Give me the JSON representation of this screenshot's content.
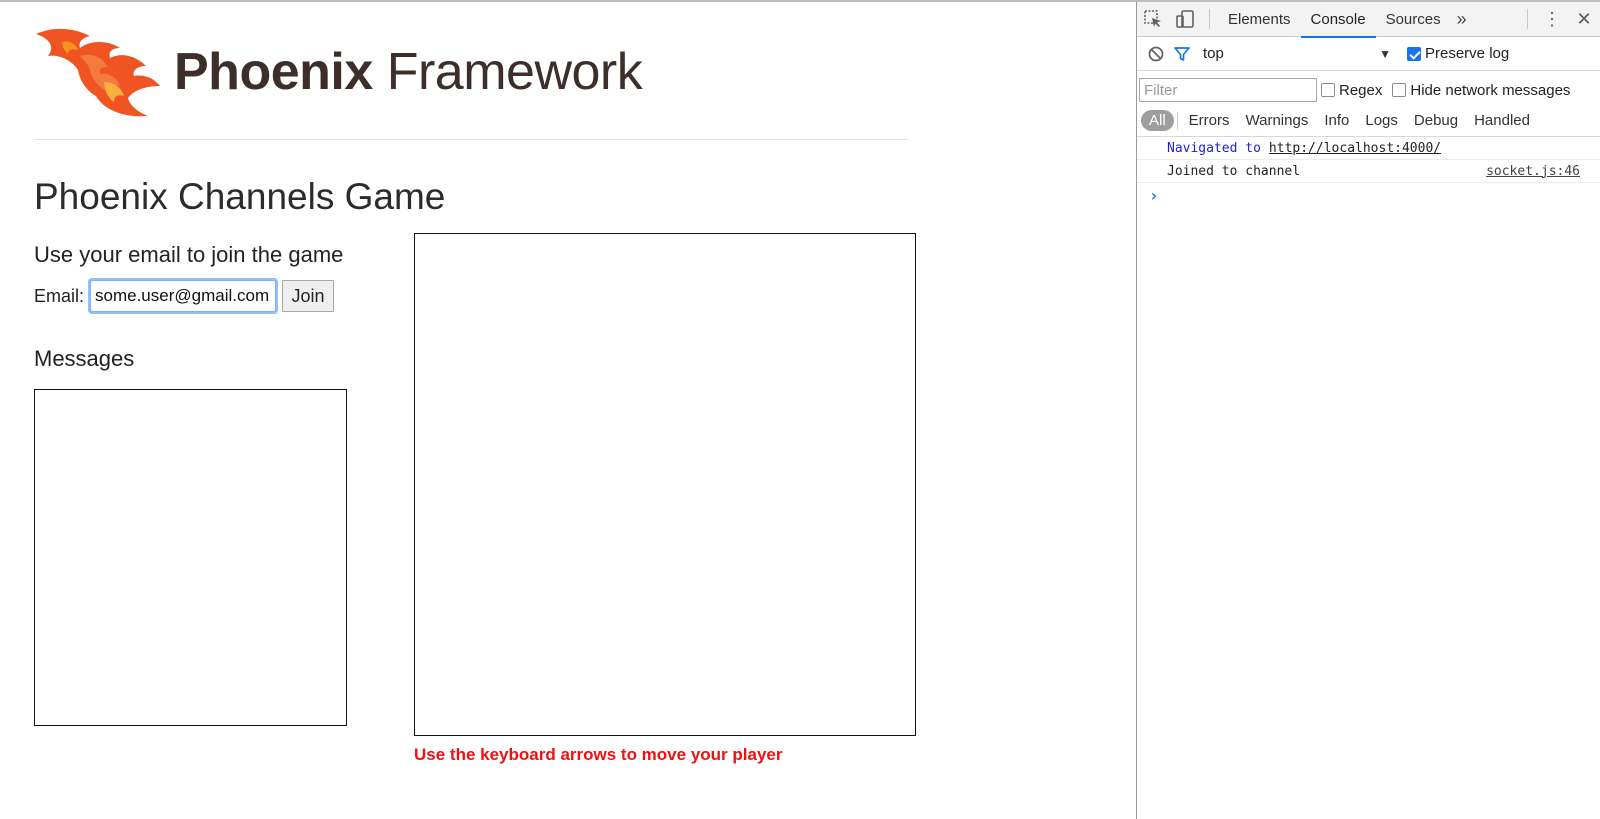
{
  "brand": {
    "name_bold": "Phoenix",
    "name_light": "Framework"
  },
  "game": {
    "title": "Phoenix Channels Game",
    "join_heading": "Use your email to join the game",
    "email_label": "Email:",
    "email_value": "some.user@gmail.com",
    "join_label": "Join",
    "messages_heading": "Messages",
    "hint": "Use the keyboard arrows to move your player"
  },
  "devtools": {
    "tabs": [
      "Elements",
      "Console",
      "Sources"
    ],
    "active_tab": "Console",
    "context": "top",
    "preserve_log_label": "Preserve log",
    "preserve_log_checked": true,
    "filter_placeholder": "Filter",
    "regex_label": "Regex",
    "hide_network_label": "Hide network messages",
    "levels": [
      "All",
      "Errors",
      "Warnings",
      "Info",
      "Logs",
      "Debug",
      "Handled"
    ],
    "messages": [
      {
        "text": "Navigated to",
        "url": "http://localhost:4000/"
      },
      {
        "text": "Joined to channel",
        "source": "socket.js:46"
      }
    ],
    "prompt": "›"
  },
  "colors": {
    "brand_orange": "#f05423",
    "hint_red": "#ee1111",
    "accent_blue": "#1a73e8"
  },
  "icons": [
    "phoenix-logo-icon",
    "inspect-element-icon",
    "device-toolbar-icon",
    "more-tabs-icon",
    "kebab-menu-icon",
    "close-icon",
    "clear-console-icon",
    "filter-icon",
    "dropdown-caret-icon"
  ]
}
